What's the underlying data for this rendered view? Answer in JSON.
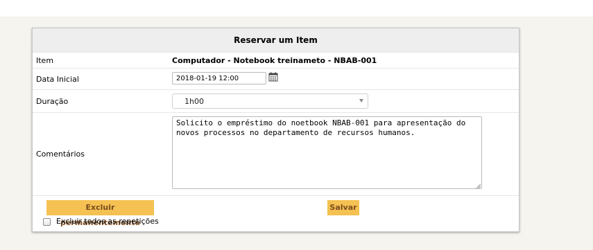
{
  "form": {
    "title": "Reservar um Item",
    "item": {
      "label": "Item",
      "value": "Computador - Notebook treinameto - NBAB-001"
    },
    "start_date": {
      "label": "Data Inicial",
      "value": "2018-01-19 12:00",
      "icon": "calendar-icon"
    },
    "duration": {
      "label": "Duração",
      "selected": "1h00",
      "icon": "chevron-down-icon"
    },
    "comments": {
      "label": "Comentários",
      "value": "Solicito o empréstimo do noetbook NBAB-001 para apresentação do novos processos no departamento de recursos humanos."
    },
    "actions": {
      "delete_label": "Excluir permanentemente",
      "save_label": "Salvar",
      "delete_all_label": "Excluir todos as repetições",
      "delete_all_checked": false
    }
  },
  "colors": {
    "button_bg": "#f4c152",
    "button_text": "#7a4b1e",
    "header_bg": "#eeeeee",
    "page_bg": "#f5f4ef"
  }
}
